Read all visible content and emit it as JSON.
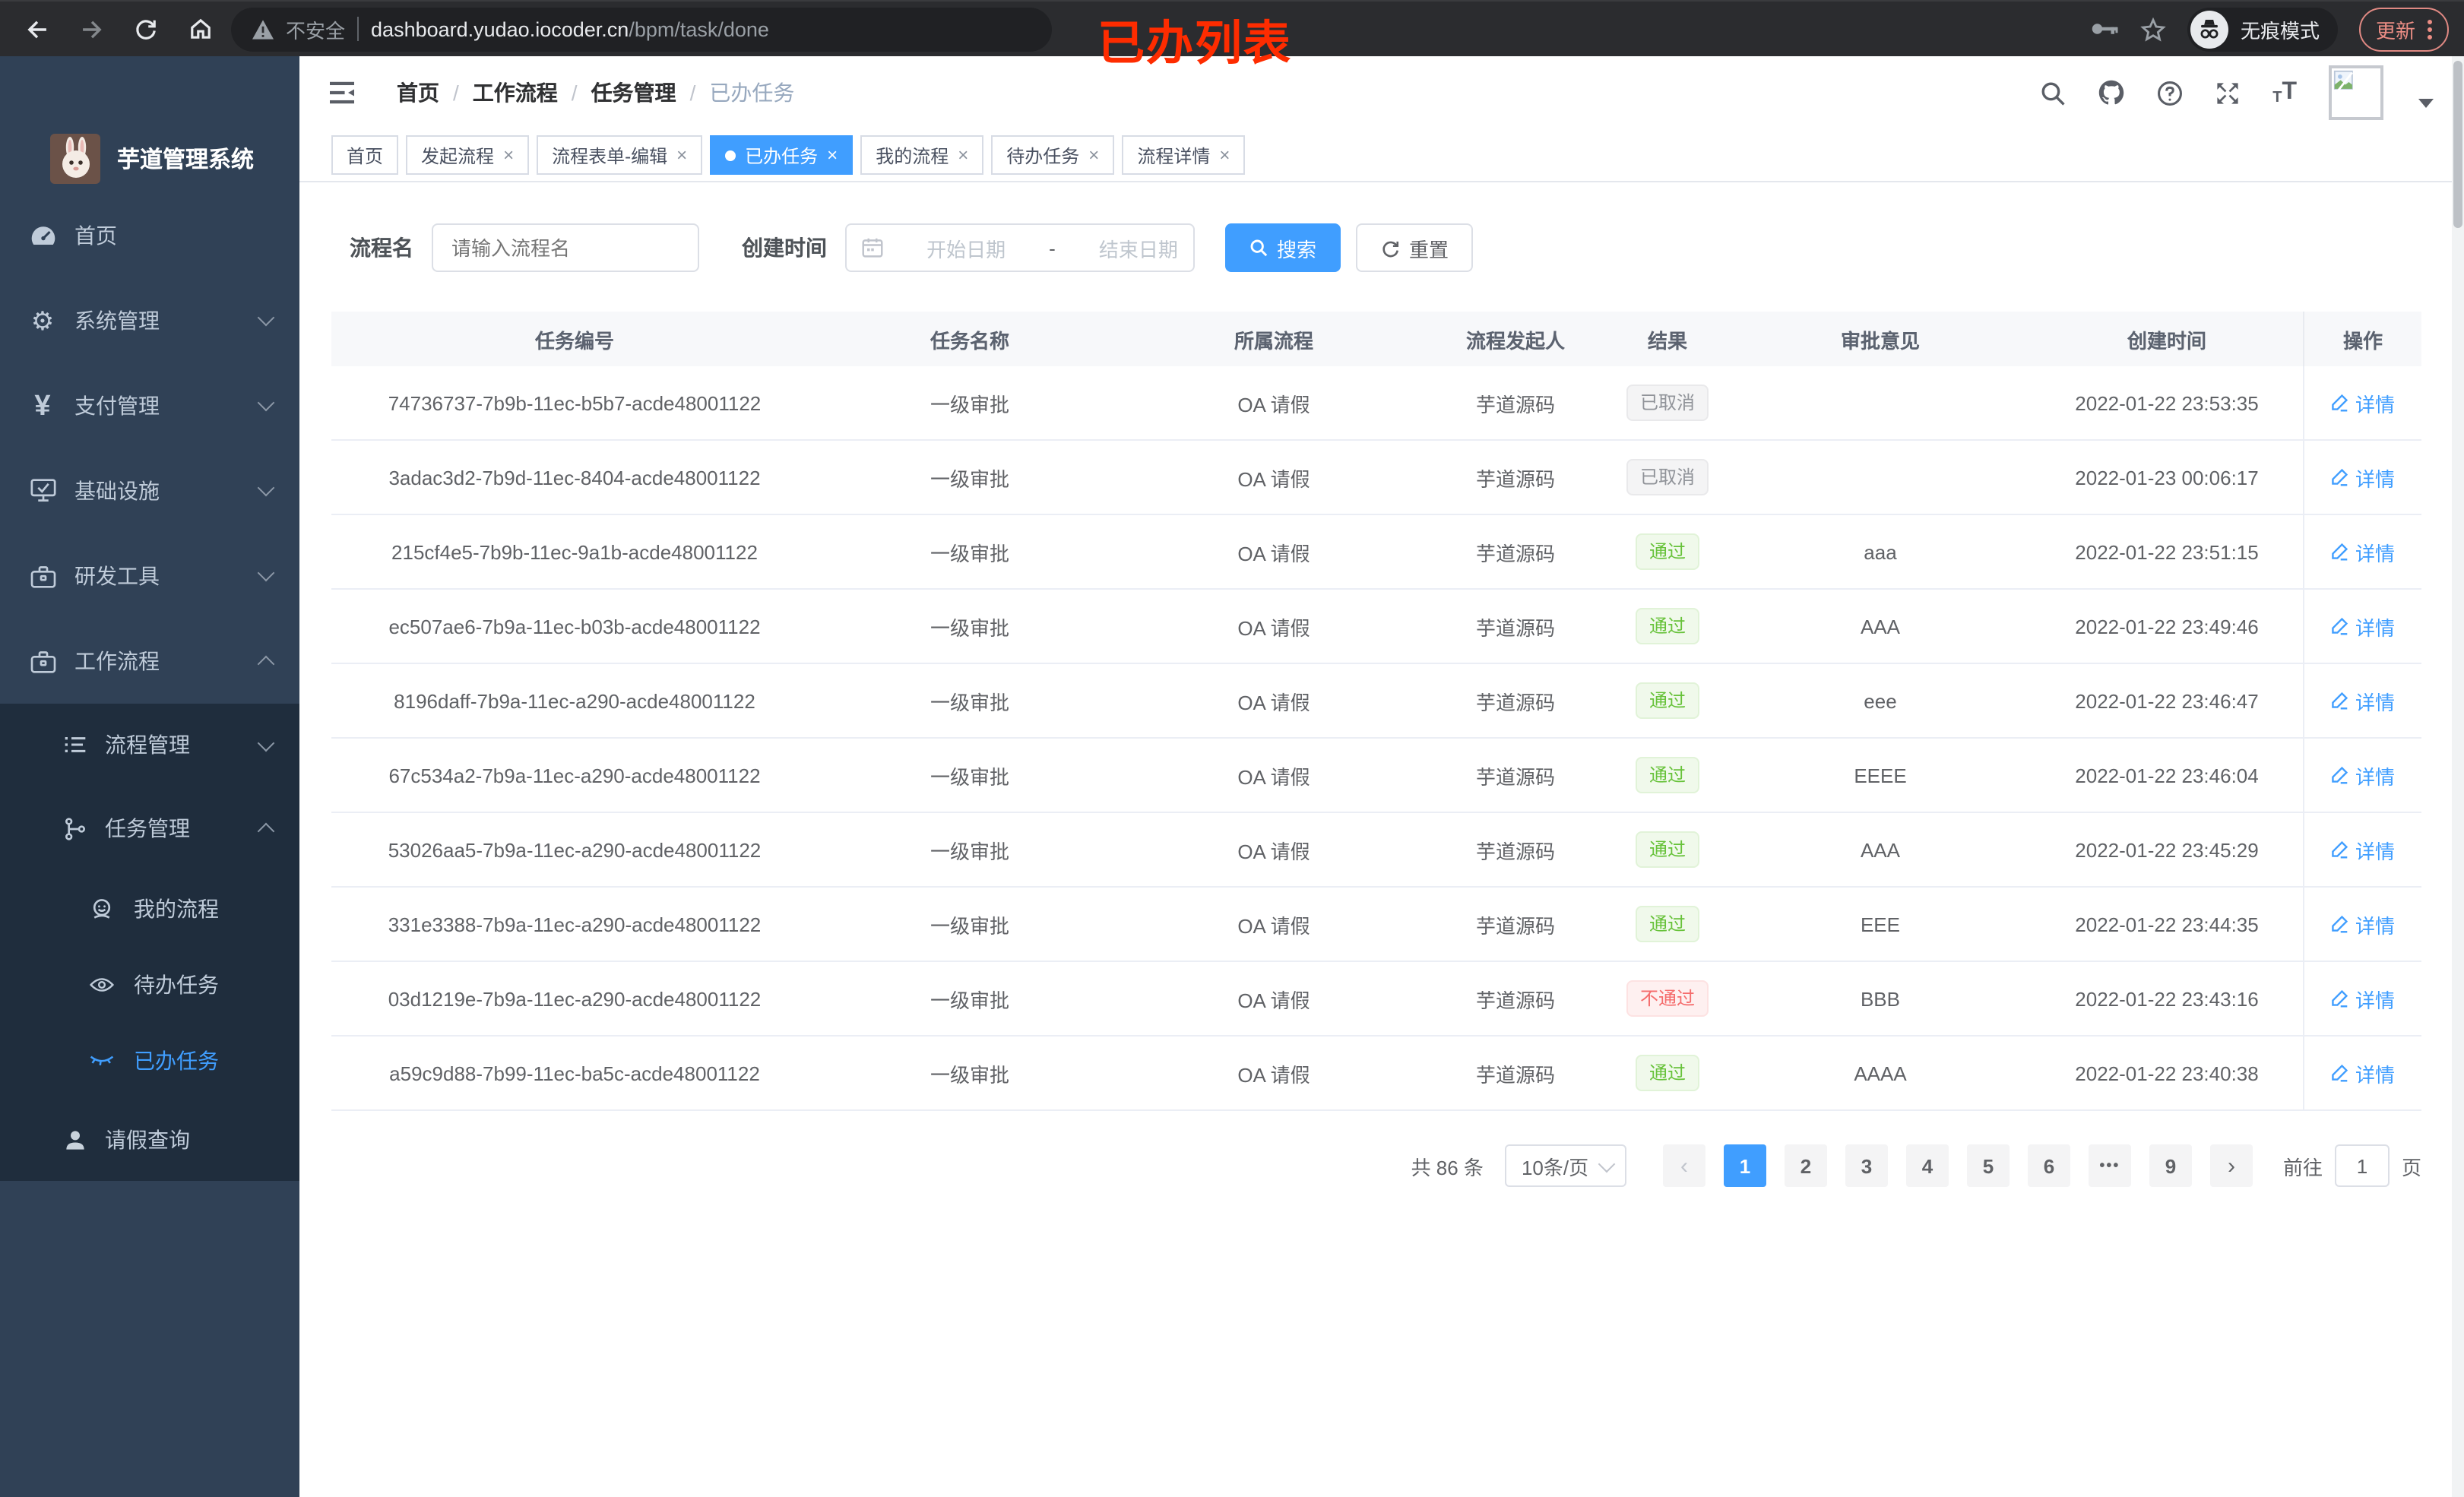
{
  "browser": {
    "security_label": "不安全",
    "url_host": "dashboard.yudao.iocoder.cn",
    "url_path": "/bpm/task/done",
    "annotation": "已办列表",
    "incognito_label": "无痕模式",
    "update_label": "更新",
    "icons": [
      "back-icon",
      "forward-icon",
      "reload-icon",
      "home-icon",
      "key-icon",
      "star-icon",
      "incognito-icon",
      "more-vertical-icon"
    ]
  },
  "sidebar": {
    "title": "芋道管理系统",
    "logo_icon": "rabbit-logo",
    "items": [
      {
        "label": "首页",
        "icon": "dashboard-icon",
        "chevron": ""
      },
      {
        "label": "系统管理",
        "icon": "gear-icon",
        "chevron": "down"
      },
      {
        "label": "支付管理",
        "icon": "yen-icon",
        "chevron": "down"
      },
      {
        "label": "基础设施",
        "icon": "monitor-icon",
        "chevron": "down"
      },
      {
        "label": "研发工具",
        "icon": "toolbox-icon",
        "chevron": "down"
      },
      {
        "label": "工作流程",
        "icon": "briefcase-icon",
        "chevron": "up"
      }
    ],
    "submenu": {
      "process_mgmt": {
        "label": "流程管理",
        "icon": "list-icon",
        "chevron": "down"
      },
      "task_mgmt": {
        "label": "任务管理",
        "icon": "tree-icon",
        "chevron": "up"
      },
      "my_process": {
        "label": "我的流程",
        "icon": "face-icon"
      },
      "todo_tasks": {
        "label": "待办任务",
        "icon": "eye-icon"
      },
      "done_tasks": {
        "label": "已办任务",
        "icon": "eye-closed-icon",
        "active": true
      },
      "leave_query": {
        "label": "请假查询",
        "icon": "user-icon"
      }
    }
  },
  "topbar": {
    "breadcrumb": {
      "0": "首页",
      "1": "工作流程",
      "2": "任务管理",
      "3": "已办任务"
    },
    "icons": [
      "search-icon",
      "github-icon",
      "help-icon",
      "fullscreen-icon",
      "font-size-icon",
      "avatar",
      "caret-down-icon"
    ]
  },
  "tabs": {
    "0": {
      "label": "首页"
    },
    "1": {
      "label": "发起流程",
      "close": "×"
    },
    "2": {
      "label": "流程表单-编辑",
      "close": "×"
    },
    "3": {
      "label": "已办任务",
      "close": "×",
      "active": true
    },
    "4": {
      "label": "我的流程",
      "close": "×"
    },
    "5": {
      "label": "待办任务",
      "close": "×"
    },
    "6": {
      "label": "流程详情",
      "close": "×"
    }
  },
  "filters": {
    "name_label": "流程名",
    "name_placeholder": "请输入流程名",
    "time_label": "创建时间",
    "start_placeholder": "开始日期",
    "range_separator": "-",
    "end_placeholder": "结束日期",
    "search_label": "搜索",
    "reset_label": "重置"
  },
  "table": {
    "columns": {
      "c0": "任务编号",
      "c1": "任务名称",
      "c2": "所属流程",
      "c3": "流程发起人",
      "c4": "结果",
      "c5": "审批意见",
      "c6": "创建时间",
      "c7": "操作"
    },
    "action_label": "详情",
    "rows": [
      {
        "id": "74736737-7b9b-11ec-b5b7-acde48001122",
        "name": "一级审批",
        "process": "OA 请假",
        "starter": "芋道源码",
        "result": {
          "text": "已取消",
          "type": "info"
        },
        "comment": "",
        "created": "2022-01-22 23:53:35"
      },
      {
        "id": "3adac3d2-7b9d-11ec-8404-acde48001122",
        "name": "一级审批",
        "process": "OA 请假",
        "starter": "芋道源码",
        "result": {
          "text": "已取消",
          "type": "info"
        },
        "comment": "",
        "created": "2022-01-23 00:06:17"
      },
      {
        "id": "215cf4e5-7b9b-11ec-9a1b-acde48001122",
        "name": "一级审批",
        "process": "OA 请假",
        "starter": "芋道源码",
        "result": {
          "text": "通过",
          "type": "success"
        },
        "comment": "aaa",
        "created": "2022-01-22 23:51:15"
      },
      {
        "id": "ec507ae6-7b9a-11ec-b03b-acde48001122",
        "name": "一级审批",
        "process": "OA 请假",
        "starter": "芋道源码",
        "result": {
          "text": "通过",
          "type": "success"
        },
        "comment": "AAA",
        "created": "2022-01-22 23:49:46"
      },
      {
        "id": "8196daff-7b9a-11ec-a290-acde48001122",
        "name": "一级审批",
        "process": "OA 请假",
        "starter": "芋道源码",
        "result": {
          "text": "通过",
          "type": "success"
        },
        "comment": "eee",
        "created": "2022-01-22 23:46:47"
      },
      {
        "id": "67c534a2-7b9a-11ec-a290-acde48001122",
        "name": "一级审批",
        "process": "OA 请假",
        "starter": "芋道源码",
        "result": {
          "text": "通过",
          "type": "success"
        },
        "comment": "EEEE",
        "created": "2022-01-22 23:46:04"
      },
      {
        "id": "53026aa5-7b9a-11ec-a290-acde48001122",
        "name": "一级审批",
        "process": "OA 请假",
        "starter": "芋道源码",
        "result": {
          "text": "通过",
          "type": "success"
        },
        "comment": "AAA",
        "created": "2022-01-22 23:45:29"
      },
      {
        "id": "331e3388-7b9a-11ec-a290-acde48001122",
        "name": "一级审批",
        "process": "OA 请假",
        "starter": "芋道源码",
        "result": {
          "text": "通过",
          "type": "success"
        },
        "comment": "EEE",
        "created": "2022-01-22 23:44:35"
      },
      {
        "id": "03d1219e-7b9a-11ec-a290-acde48001122",
        "name": "一级审批",
        "process": "OA 请假",
        "starter": "芋道源码",
        "result": {
          "text": "不通过",
          "type": "danger"
        },
        "comment": "BBB",
        "created": "2022-01-22 23:43:16"
      },
      {
        "id": "a59c9d88-7b99-11ec-ba5c-acde48001122",
        "name": "一级审批",
        "process": "OA 请假",
        "starter": "芋道源码",
        "result": {
          "text": "通过",
          "type": "success"
        },
        "comment": "AAAA",
        "created": "2022-01-22 23:40:38"
      }
    ]
  },
  "pagination": {
    "total": "共 86 条",
    "page_size": "10条/页",
    "prev": "‹",
    "next": "›",
    "pages": {
      "0": "1",
      "1": "2",
      "2": "3",
      "3": "4",
      "4": "5",
      "5": "6",
      "6": "•••",
      "7": "9"
    },
    "active_page": "1",
    "goto_label": "前往",
    "goto_value": "1",
    "unit_label": "页"
  },
  "colors": {
    "accent": "#409eff",
    "success": "#67c23a",
    "danger": "#f56c6c",
    "info": "#909399",
    "sidebar_bg": "#304156",
    "submenu_bg": "#1f2d3d",
    "annotation_red": "#fe2c00",
    "update_pill": "#eb8d84"
  }
}
